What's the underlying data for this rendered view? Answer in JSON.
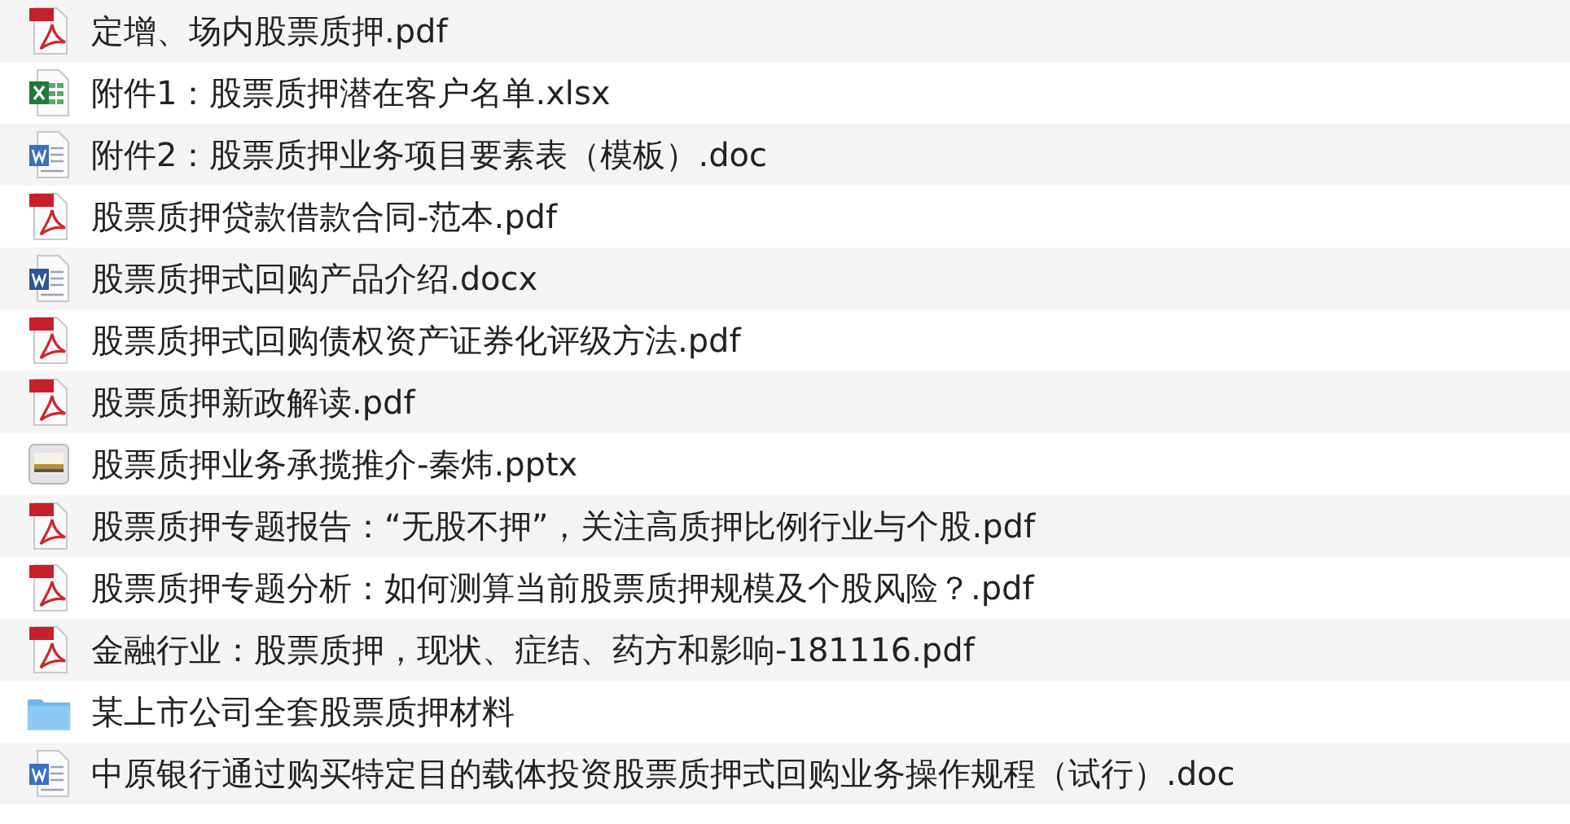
{
  "files": [
    {
      "kind": "pdf",
      "name": "定增、场内股票质押.pdf"
    },
    {
      "kind": "excel",
      "name": "附件1：股票质押潜在客户名单.xlsx"
    },
    {
      "kind": "word-old",
      "name": "附件2：股票质押业务项目要素表（模板）.doc"
    },
    {
      "kind": "pdf",
      "name": "股票质押贷款借款合同-范本.pdf"
    },
    {
      "kind": "word",
      "name": "股票质押式回购产品介绍.docx"
    },
    {
      "kind": "pdf",
      "name": "股票质押式回购债权资产证券化评级方法.pdf"
    },
    {
      "kind": "pdf",
      "name": "股票质押新政解读.pdf"
    },
    {
      "kind": "slides",
      "name": "股票质押业务承揽推介-秦炜.pptx"
    },
    {
      "kind": "pdf",
      "name": "股票质押专题报告：“无股不押”，关注高质押比例行业与个股.pdf"
    },
    {
      "kind": "pdf",
      "name": "股票质押专题分析：如何测算当前股票质押规模及个股风险？.pdf"
    },
    {
      "kind": "pdf",
      "name": "金融行业：股票质押，现状、症结、药方和影响-181116.pdf"
    },
    {
      "kind": "folder",
      "name": "某上市公司全套股票质押材料"
    },
    {
      "kind": "word-old",
      "name": "中原银行通过购买特定目的载体投资股票质押式回购业务操作规程（试行）.doc"
    }
  ]
}
